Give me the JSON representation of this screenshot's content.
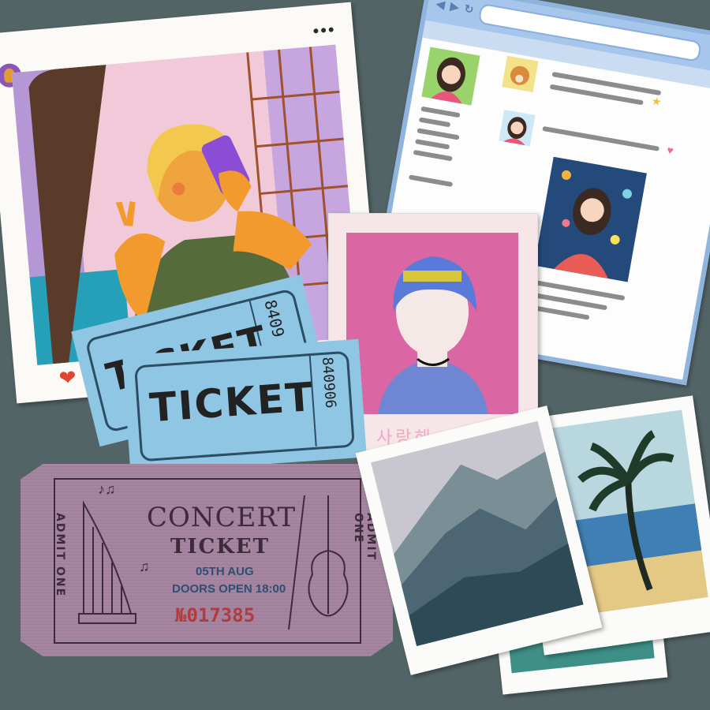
{
  "post": {
    "menu_icon": "more-dots-icon",
    "like_icon": "heart-icon"
  },
  "polaroid": {
    "caption": "사랑해"
  },
  "tickets": {
    "back": {
      "word": "TICKET",
      "serial": "8409"
    },
    "front": {
      "word": "TICKET",
      "serial": "840906"
    }
  },
  "concert": {
    "admit_left": "ADMIT ONE",
    "admit_right": "ADMIT ONE",
    "title": "CONCERT",
    "subtitle": "TICKET",
    "date": "05TH AUG",
    "doors": "DOORS OPEN 18:00",
    "number": "№017385"
  },
  "colors": {
    "background": "#536467",
    "ticket_blue": "#8fc6e3",
    "concert_ticket": "#a585a0",
    "polaroid_pink": "#da66a4"
  }
}
